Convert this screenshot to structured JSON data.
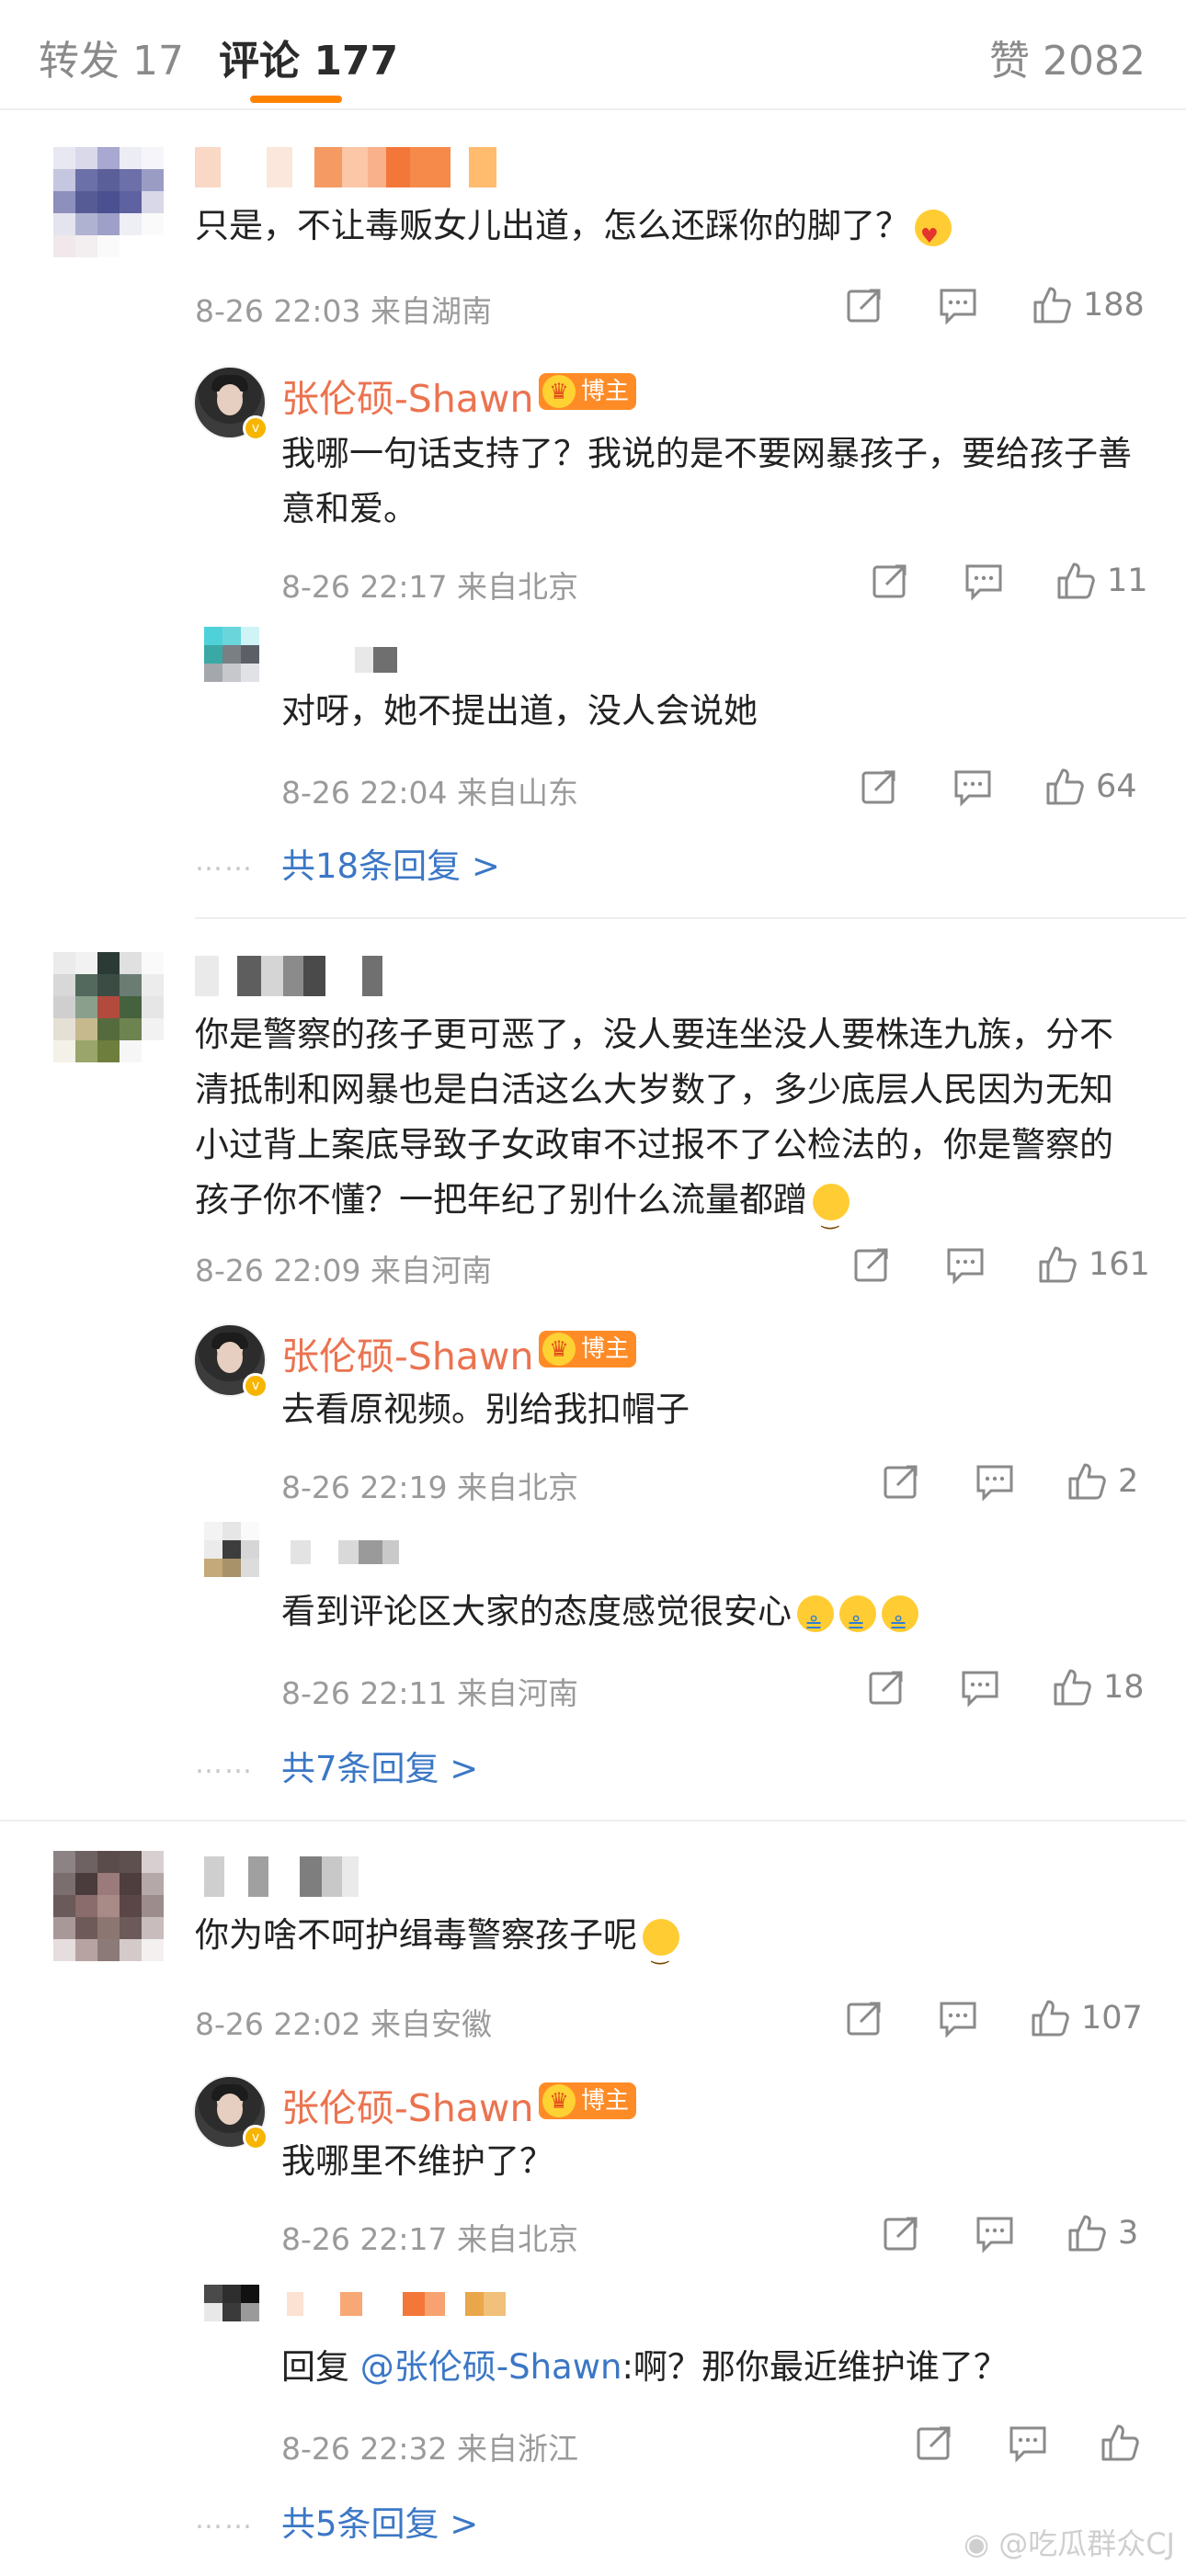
{
  "tabs": {
    "repost": "转发 17",
    "comments": "评论 177",
    "likes": "赞 2082"
  },
  "colors": {
    "accent": "#ff8200",
    "link": "#3b77c6",
    "author_name": "#eb7350"
  },
  "author": {
    "name": "张伦硕-Shawn",
    "tag": "博主"
  },
  "threads": [
    {
      "text": "只是，不让毒贩女儿出道，怎么还踩你的脚了？",
      "meta": "8-26 22:03  来自湖南",
      "likes": "188",
      "replies": [
        {
          "author": "张伦硕-Shawn",
          "text": "我哪一句话支持了？我说的是不要网暴孩子，要给孩子善意和爱。",
          "meta": "8-26 22:17  来自北京",
          "likes": "11"
        },
        {
          "author": "",
          "text": "对呀，她不提出道，没人会说她",
          "meta": "8-26 22:04  来自山东",
          "likes": "64"
        }
      ],
      "more": "共18条回复 >"
    },
    {
      "text": "你是警察的孩子更可恶了，没人要连坐没人要株连九族，分不清抵制和网暴也是白活这么大岁数了，多少底层人民因为无知小过背上案底导致子女政审不过报不了公检法的，你是警察的孩子你不懂？一把年纪了别什么流量都蹭",
      "meta": "8-26 22:09  来自河南",
      "likes": "161",
      "replies": [
        {
          "author": "张伦硕-Shawn",
          "text": "去看原视频。别给我扣帽子",
          "meta": "8-26 22:19  来自北京",
          "likes": "2"
        },
        {
          "author": "",
          "text": "看到评论区大家的态度感觉很安心",
          "meta": "8-26 22:11  来自河南",
          "likes": "18"
        }
      ],
      "more": "共7条回复 >"
    },
    {
      "text": "你为啥不呵护缉毒警察孩子呢",
      "meta": "8-26 22:02  来自安徽",
      "likes": "107",
      "replies": [
        {
          "author": "张伦硕-Shawn",
          "text": "我哪里不维护了？",
          "meta": "8-26 22:17  来自北京",
          "likes": "3"
        },
        {
          "author": "",
          "reply_prefix": "回复",
          "mention": "@张伦硕-Shawn",
          "text": ":啊？那你最近维护谁了？",
          "meta": "8-26 22:32  来自浙江",
          "likes": ""
        }
      ],
      "more": "共5条回复 >"
    }
  ],
  "dots": "……",
  "watermark": "@吃瓜群众CJ"
}
